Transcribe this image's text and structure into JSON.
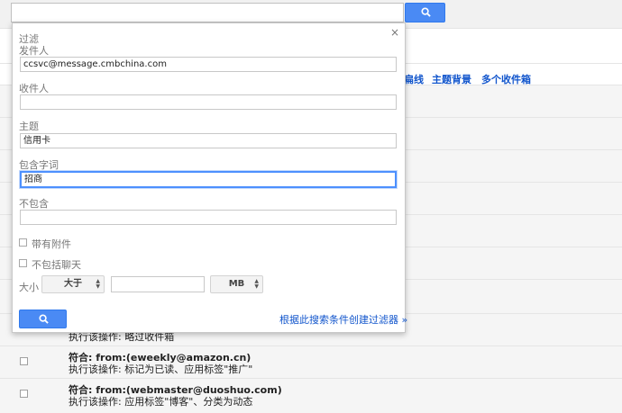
{
  "search": {
    "query": ""
  },
  "background": {
    "tabs": [
      "扁线",
      "主题背景",
      "多个收件箱"
    ],
    "rules": [
      {
        "cond": "",
        "action": "执行该操作: 略过收件箱"
      },
      {
        "cond": "符合: from:(eweekly@amazon.cn)",
        "action": "执行该操作: 标记为已读、应用标签\"推广\""
      },
      {
        "cond": "符合: from:(webmaster@duoshuo.com)",
        "action": "执行该操作: 应用标签\"博客\"、分类为动态"
      }
    ]
  },
  "filter": {
    "title": "过滤",
    "close": "×",
    "from_label": "发件人",
    "from_value": "ccsvc@message.cmbchina.com",
    "to_label": "收件人",
    "to_value": "",
    "subject_label": "主题",
    "subject_value": "信用卡",
    "has_words_label": "包含字词",
    "has_words_value": "招商",
    "not_words_label": "不包含",
    "not_words_value": "",
    "attachment_label": "带有附件",
    "no_chats_label": "不包括聊天",
    "size_label": "大小",
    "size_op": "大于",
    "size_value": "",
    "size_unit": "MB",
    "create_link": "根据此搜索条件创建过滤器 »"
  },
  "colors": {
    "accent": "#4a8af4",
    "link": "#1155cc",
    "focus": "#4d90fe"
  },
  "icons": {
    "search": "search-icon"
  }
}
